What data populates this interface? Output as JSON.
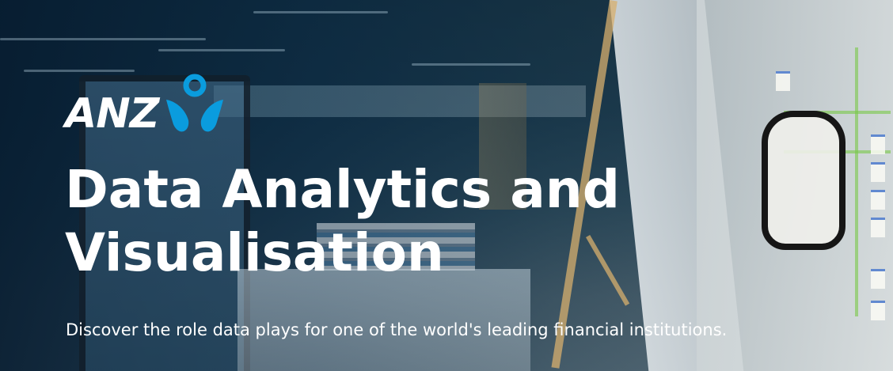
{
  "brand": {
    "name": "ANZ",
    "colors": {
      "text": "#ffffff",
      "mark": "#0a9cde"
    },
    "logo_icon": "anz-people-logo-icon"
  },
  "hero": {
    "title_line_1": "Data Analytics and",
    "title_line_2": "Visualisation",
    "subtitle": "Discover the role data plays for one of the world's leading financial institutions."
  }
}
